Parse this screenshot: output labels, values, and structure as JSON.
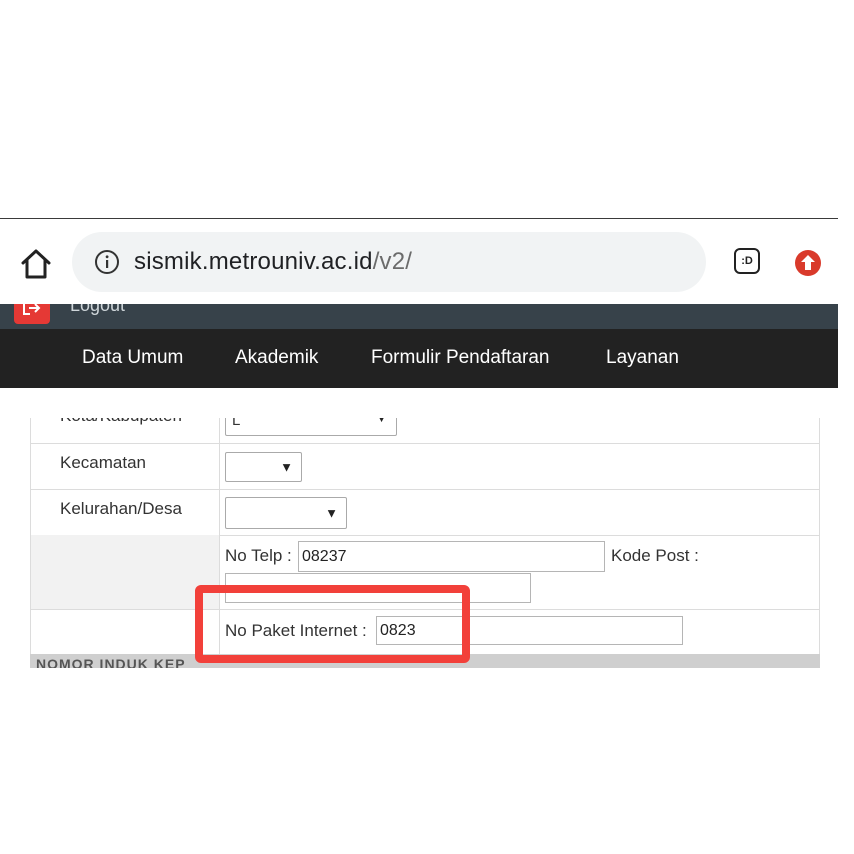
{
  "browser": {
    "url_host": "sismik.metrouniv.ac.id",
    "url_path": "/v2/",
    "extension_label": ":D"
  },
  "header": {
    "logout_label": "Logout"
  },
  "nav": {
    "items": [
      "Data Umum",
      "Akademik",
      "Formulir Pendaftaran",
      "Layanan"
    ]
  },
  "form": {
    "kota_label": "Kota/Kabupaten",
    "kota_value": "L",
    "kecamatan_label": "Kecamatan",
    "kecamatan_value": "",
    "kelurahan_label": "Kelurahan/Desa",
    "kelurahan_value": "",
    "no_telp_label": "No Telp :",
    "no_telp_value": "08237",
    "kode_post_label": "Kode Post :",
    "no_paket_label": "No Paket Internet :",
    "no_paket_value": "0823",
    "next_section": "NOMOR INDUK KEP"
  },
  "colors": {
    "nav_bg": "#222222",
    "logout_bar_bg": "#37424a",
    "highlight": "#f2403a"
  }
}
